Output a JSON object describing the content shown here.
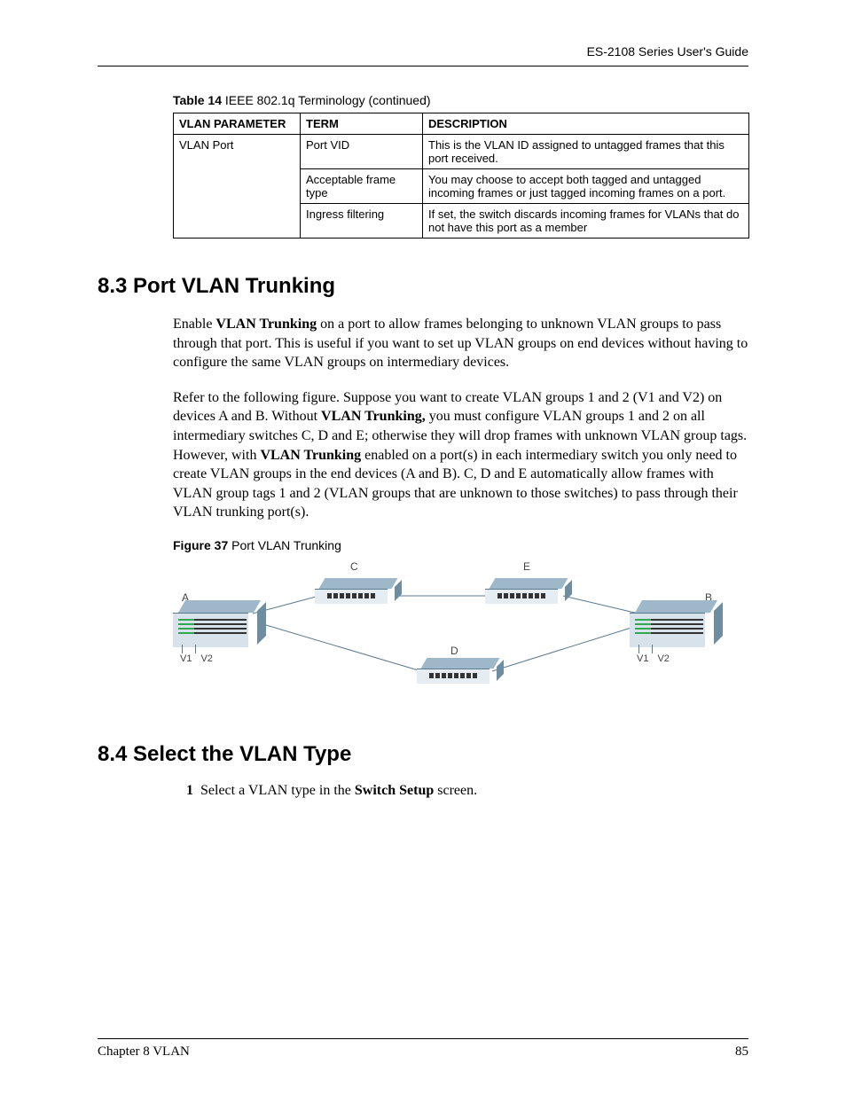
{
  "header": {
    "guide": "ES-2108 Series User's Guide"
  },
  "table": {
    "caption_bold": "Table 14",
    "caption_rest": "   IEEE 802.1q Terminology  (continued)",
    "headers": {
      "param": "VLAN PARAMETER",
      "term": "TERM",
      "desc": "DESCRIPTION"
    },
    "param_cell": "VLAN Port",
    "rows": [
      {
        "term": "Port VID",
        "desc": "This is the VLAN ID assigned to untagged frames that this port received."
      },
      {
        "term": "Acceptable frame type",
        "desc": "You may choose to accept both tagged and untagged incoming frames or just tagged incoming frames on a port."
      },
      {
        "term": "Ingress filtering",
        "desc": "If set, the switch discards incoming frames for VLANs that do not have this port as a member"
      }
    ]
  },
  "section_8_3": {
    "heading": "8.3  Port VLAN Trunking",
    "para1_pre": "Enable ",
    "para1_bold": "VLAN Trunking",
    "para1_post": " on a port to allow frames belonging to unknown VLAN groups to pass through that port. This is useful if you want to set up VLAN groups on end devices without having to configure the same VLAN groups on intermediary devices.",
    "para2_a": "Refer to the following figure. Suppose you want to create VLAN groups 1 and 2 (V1 and V2) on devices A and B. Without ",
    "para2_b_bold": "VLAN Trunking,",
    "para2_c": " you must configure VLAN groups 1 and 2 on all intermediary switches C, D and E; otherwise they will drop frames with unknown VLAN group tags. However, with ",
    "para2_d_bold": "VLAN Trunking",
    "para2_e": " enabled on a port(s) in each intermediary switch you only need to create VLAN groups in the end devices (A and B). C, D and E automatically allow frames with VLAN group tags 1 and 2 (VLAN groups that are unknown to those switches) to pass through their VLAN trunking port(s)."
  },
  "figure": {
    "caption_bold": "Figure 37",
    "caption_rest": "   Port VLAN Trunking",
    "labels": {
      "A": "A",
      "B": "B",
      "C": "C",
      "D": "D",
      "E": "E",
      "V1": "V1",
      "V2": "V2"
    }
  },
  "section_8_4": {
    "heading": "8.4  Select the VLAN Type",
    "step_num": "1",
    "step_a": "Select a VLAN type in the ",
    "step_bold": "Switch Setup",
    "step_b": " screen."
  },
  "footer": {
    "left": "Chapter 8 VLAN",
    "right": "85"
  }
}
